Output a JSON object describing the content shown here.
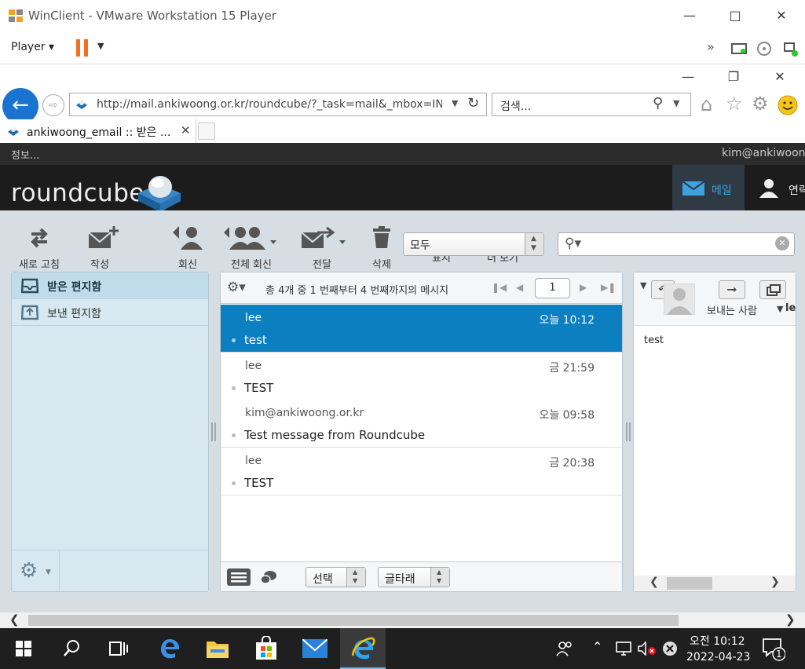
{
  "vmware": {
    "title": "WinClient - VMware Workstation 15 Player",
    "player_menu": "Player",
    "window_controls": [
      "minimize-icon",
      "maximize-icon",
      "close-icon"
    ]
  },
  "ie": {
    "address": "http://mail.ankiwoong.or.kr/roundcube/?_task=mail&_mbox=INB",
    "search_placeholder": "검색...",
    "tab_title": "ankiwoong_email :: 받은 ..."
  },
  "roundcube": {
    "info": "정보...",
    "user": "kim@ankiwoong",
    "logo": "roundcube",
    "nav": {
      "mail": "메일",
      "contacts": "연락"
    },
    "toolbar": {
      "refresh": "새로 고침",
      "compose": "작성",
      "reply": "회신",
      "reply_all": "전체 회신",
      "forward": "전달",
      "delete": "삭제",
      "filter_value": "모두",
      "hidden_labels": [
        "표시",
        "더 보기"
      ]
    },
    "folders": [
      {
        "name": "받은 편지함",
        "selected": true
      },
      {
        "name": "보낸 편지함",
        "selected": false
      }
    ],
    "list_header": {
      "count_text": "총 4개 중 1 번째부터 4 번째까지의 메시지",
      "page": "1"
    },
    "messages": [
      {
        "from": "lee",
        "date": "오늘 10:12",
        "subject": "test",
        "selected": true
      },
      {
        "from": "lee",
        "date": "금 21:59",
        "subject": "TEST",
        "selected": false
      },
      {
        "from": "kim@ankiwoong.or.kr",
        "date": "오늘 09:58",
        "subject": "Test message from Roundcube",
        "selected": false
      },
      {
        "from": "lee",
        "date": "금 20:38",
        "subject": "TEST",
        "selected": false
      }
    ],
    "list_footer": {
      "select": "선택",
      "threads": "글타래"
    },
    "preview": {
      "sender_label": "보내는 사람",
      "sender_value": "lee",
      "body": "test"
    }
  },
  "taskbar": {
    "time": "오전 10:12",
    "date": "2022-04-23",
    "notification_count": "1"
  }
}
